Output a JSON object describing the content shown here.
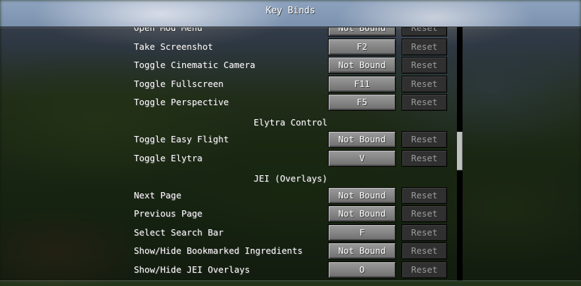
{
  "screen": {
    "title": "Key Binds"
  },
  "rows_top": [
    {
      "label": "Open Mod Menu",
      "key": "Not Bound",
      "reset": "Reset"
    },
    {
      "label": "Take Screenshot",
      "key": "F2",
      "reset": "Reset"
    },
    {
      "label": "Toggle Cinematic Camera",
      "key": "Not Bound",
      "reset": "Reset"
    },
    {
      "label": "Toggle Fullscreen",
      "key": "F11",
      "reset": "Reset"
    },
    {
      "label": "Toggle Perspective",
      "key": "F5",
      "reset": "Reset"
    }
  ],
  "category_elytra": "Elytra Control",
  "rows_elytra": [
    {
      "label": "Toggle Easy Flight",
      "key": "Not Bound",
      "reset": "Reset"
    },
    {
      "label": "Toggle Elytra",
      "key": "V",
      "reset": "Reset"
    }
  ],
  "category_jei": "JEI (Overlays)",
  "rows_jei": [
    {
      "label": "Next Page",
      "key": "Not Bound",
      "reset": "Reset"
    },
    {
      "label": "Previous Page",
      "key": "Not Bound",
      "reset": "Reset"
    },
    {
      "label": "Select Search Bar",
      "key": "F",
      "reset": "Reset"
    },
    {
      "label": "Show/Hide Bookmarked Ingredients",
      "key": "Not Bound",
      "reset": "Reset"
    },
    {
      "label": "Show/Hide JEI Overlays",
      "key": "O",
      "reset": "Reset"
    }
  ],
  "scrollbar": {
    "position_fraction": 0.42
  }
}
